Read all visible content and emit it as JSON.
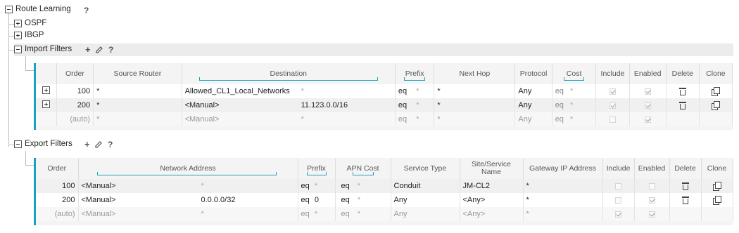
{
  "tree": {
    "route_learning": "Route Learning",
    "help": "?",
    "ospf": "OSPF",
    "ibgp": "IBGP",
    "import_filters": "Import Filters",
    "export_filters": "Export Filters",
    "add_icon": "+",
    "edit_icon": "pencil-icon"
  },
  "import_table": {
    "headers": {
      "order": "Order",
      "source_router": "Source Router",
      "destination": "Destination",
      "prefix": "Prefix",
      "next_hop": "Next Hop",
      "protocol": "Protocol",
      "cost": "Cost",
      "include": "Include",
      "enabled": "Enabled",
      "delete": "Delete",
      "clone": "Clone"
    },
    "rows": [
      {
        "order": "100",
        "source_router": "*",
        "destination": "Allowed_CL1_Local_Networks",
        "dest_ip": "*",
        "prefix_op": "eq",
        "prefix": "*",
        "next_hop": "*",
        "protocol": "Any",
        "cost_op": "eq",
        "cost": "*"
      },
      {
        "order": "200",
        "source_router": "*",
        "destination": "<Manual>",
        "dest_ip": "11.123.0.0/16",
        "prefix_op": "eq",
        "prefix": "*",
        "next_hop": "*",
        "protocol": "Any",
        "cost_op": "eq",
        "cost": "*"
      },
      {
        "order": "(auto)",
        "source_router": "*",
        "destination": "<Manual>",
        "dest_ip": "*",
        "prefix_op": "eq",
        "prefix": "*",
        "next_hop": "*",
        "protocol": "Any",
        "cost_op": "eq",
        "cost": "*"
      }
    ]
  },
  "export_table": {
    "headers": {
      "order": "Order",
      "network_address": "Network Address",
      "prefix": "Prefix",
      "apn_cost": "APN Cost",
      "service_type": "Service Type",
      "site_service_name": "Site/Service Name",
      "gateway_ip": "Gateway IP Address",
      "include": "Include",
      "enabled": "Enabled",
      "delete": "Delete",
      "clone": "Clone"
    },
    "rows": [
      {
        "order": "100",
        "network": "<Manual>",
        "net_ip": "*",
        "prefix_op": "eq",
        "prefix": "*",
        "cost_op": "eq",
        "cost": "*",
        "service_type": "Conduit",
        "site": "JM-CL2",
        "gateway": "*"
      },
      {
        "order": "200",
        "network": "<Manual>",
        "net_ip": "0.0.0.0/32",
        "prefix_op": "eq",
        "prefix": "0",
        "cost_op": "eq",
        "cost": "*",
        "service_type": "Any",
        "site": "<Any>",
        "gateway": "*"
      },
      {
        "order": "(auto)",
        "network": "<Manual>",
        "net_ip": "*",
        "prefix_op": "eq",
        "prefix": "*",
        "cost_op": "eq",
        "cost": "*",
        "service_type": "Any",
        "site": "<Any>",
        "gateway": "*"
      }
    ]
  },
  "colors": {
    "accent": "#1aa3b8",
    "header_band": "#ececec"
  }
}
